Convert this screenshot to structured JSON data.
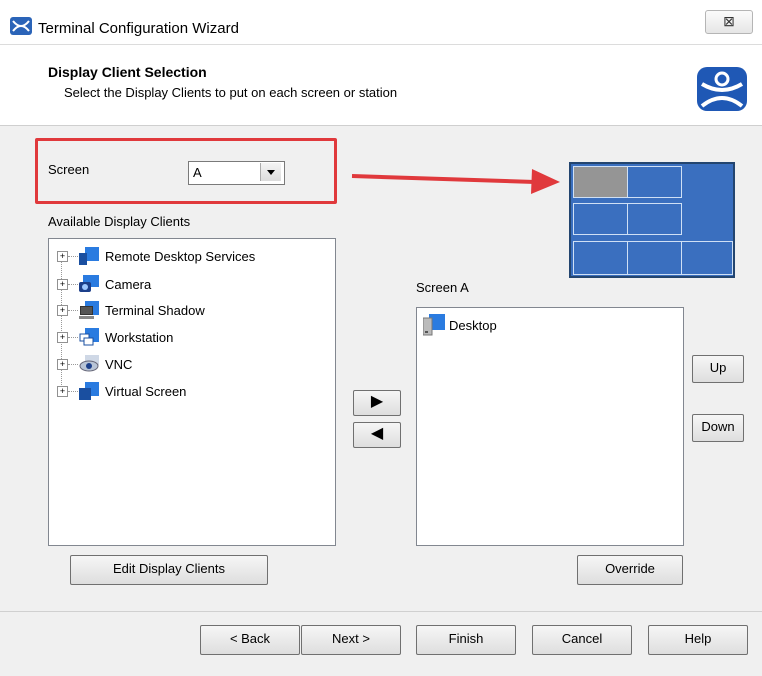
{
  "window": {
    "title": "Terminal Configuration Wizard",
    "close_glyph": "⊠"
  },
  "header": {
    "title": "Display Client Selection",
    "subtitle": "Select the Display Clients to put on each screen or station"
  },
  "screen_select": {
    "label": "Screen",
    "value": "A"
  },
  "available": {
    "label": "Available Display Clients",
    "items": [
      {
        "label": "Remote Desktop Services",
        "icon": "remote-desktop-icon"
      },
      {
        "label": "Camera",
        "icon": "camera-icon"
      },
      {
        "label": "Terminal Shadow",
        "icon": "terminal-shadow-icon"
      },
      {
        "label": "Workstation",
        "icon": "workstation-icon"
      },
      {
        "label": "VNC",
        "icon": "vnc-icon"
      },
      {
        "label": "Virtual Screen",
        "icon": "virtual-screen-icon"
      }
    ],
    "expand_glyph": "+"
  },
  "assigned": {
    "label": "Screen A",
    "items": [
      {
        "label": "Desktop",
        "icon": "desktop-icon"
      }
    ]
  },
  "buttons": {
    "edit_clients": "Edit Display Clients",
    "override": "Override",
    "up": "Up",
    "down": "Down",
    "add_glyph": "▶",
    "remove_glyph": "◀",
    "back": "< Back",
    "next": "Next >",
    "finish": "Finish",
    "cancel": "Cancel",
    "help": "Help"
  },
  "colors": {
    "highlight": "#e0393c",
    "screen_blue": "#3a6fbf",
    "selected_cell": "#959595"
  }
}
